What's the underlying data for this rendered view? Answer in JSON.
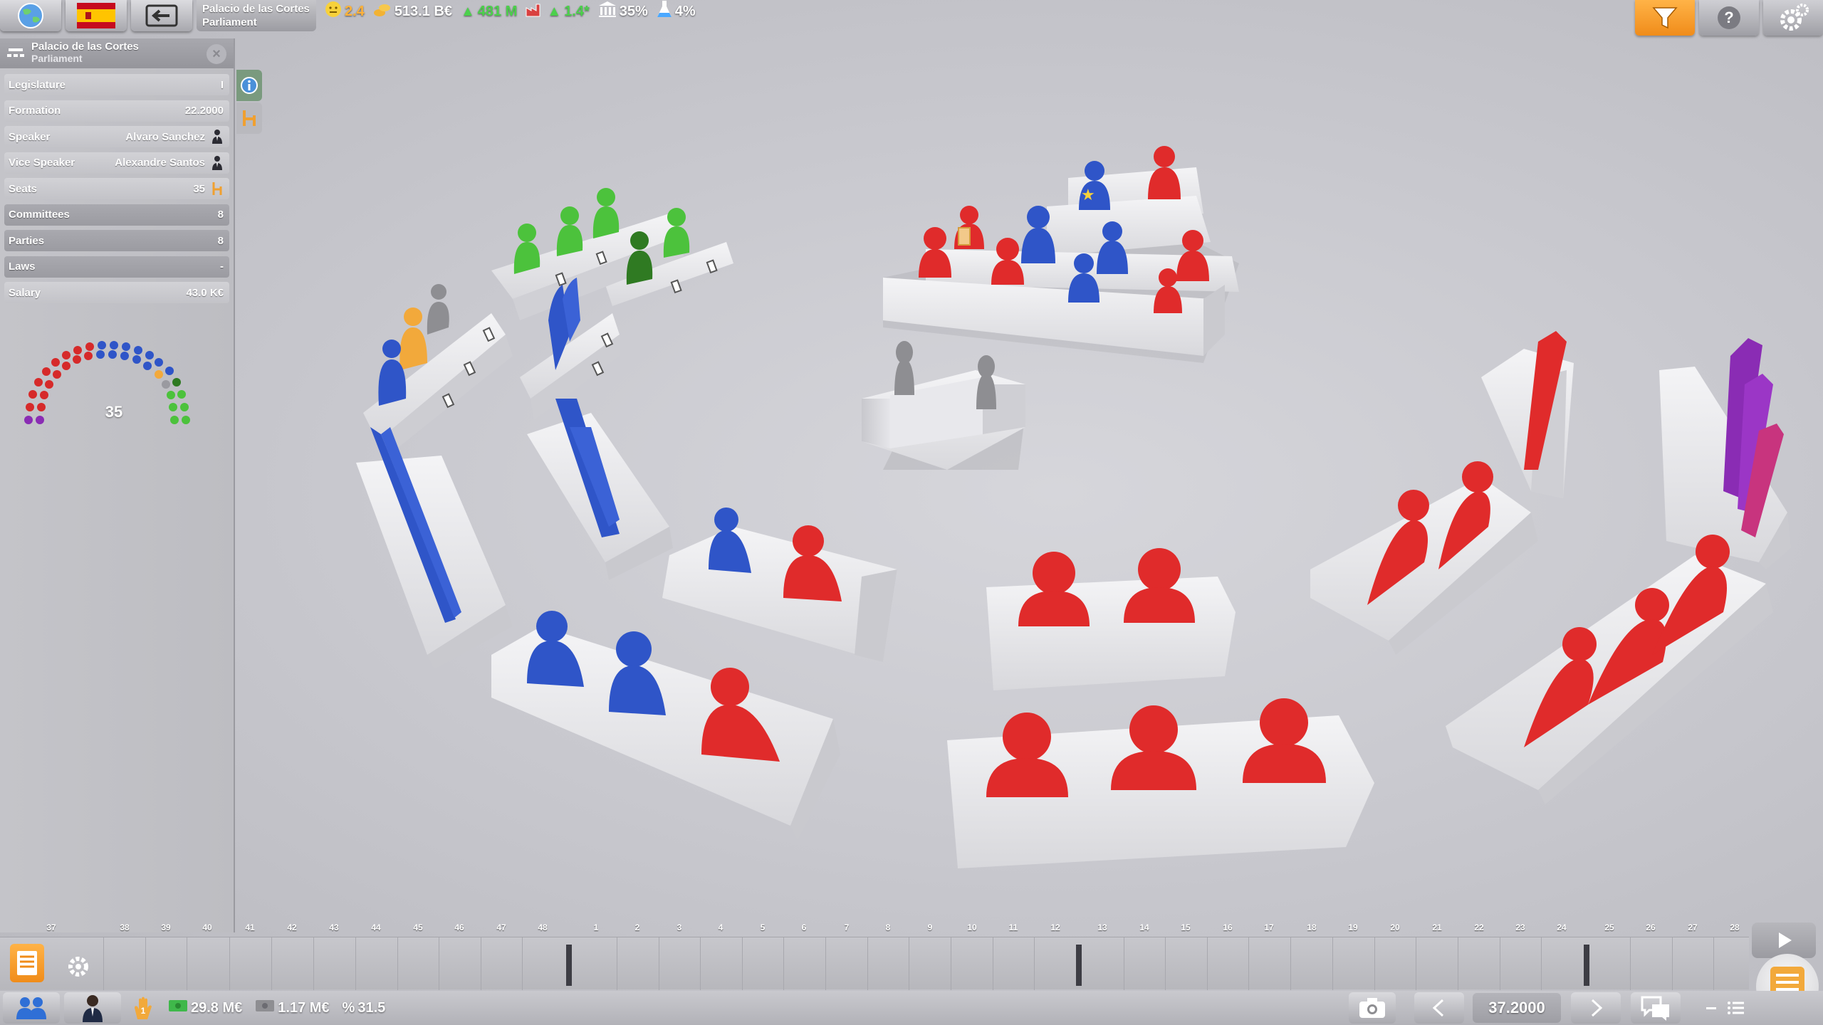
{
  "topbar": {
    "place_title": "Palacio de las Cortes",
    "place_subtitle": "Parliament",
    "stats": {
      "happiness": "2.4",
      "money": "513.1 B€",
      "growth": "481 M",
      "industry": "1.4*",
      "govt": "35%",
      "research": "4%"
    }
  },
  "panel": {
    "title": "Palacio de las Cortes",
    "subtitle": "Parliament",
    "close_label": "×",
    "rows": [
      {
        "label": "Legislature",
        "value": "I"
      },
      {
        "label": "Formation",
        "value": "22.2000"
      },
      {
        "label": "Speaker",
        "value": "Alvaro Sanchez"
      },
      {
        "label": "Vice Speaker",
        "value": "Alexandre Santos"
      },
      {
        "label": "Seats",
        "value": "35"
      },
      {
        "label": "Committees",
        "value": "8"
      },
      {
        "label": "Parties",
        "value": "8"
      },
      {
        "label": "Laws",
        "value": "-"
      },
      {
        "label": "Salary",
        "value": "43.0 K€"
      }
    ],
    "seat_total": "35"
  },
  "timeline": {
    "numbers": [
      "37",
      "38",
      "39",
      "40",
      "41",
      "42",
      "43",
      "44",
      "45",
      "46",
      "47",
      "48",
      "1",
      "2",
      "3",
      "4",
      "5",
      "6",
      "7",
      "8",
      "9",
      "10",
      "11",
      "12",
      "13",
      "14",
      "15",
      "16",
      "17",
      "18",
      "19",
      "20",
      "21",
      "22",
      "23",
      "24",
      "25",
      "26",
      "27",
      "28"
    ]
  },
  "bottombar": {
    "budget": "29.8 M€",
    "income": "1.17 M€",
    "percent": "31.5",
    "date": "37.2000"
  },
  "colors": {
    "red": "#e02b2b",
    "blue": "#2f55c8",
    "green": "#4cc23c",
    "dark_green": "#2f7a22",
    "purple": "#8a2cb4",
    "orange": "#f2a93b",
    "grey": "#8e8e92"
  }
}
